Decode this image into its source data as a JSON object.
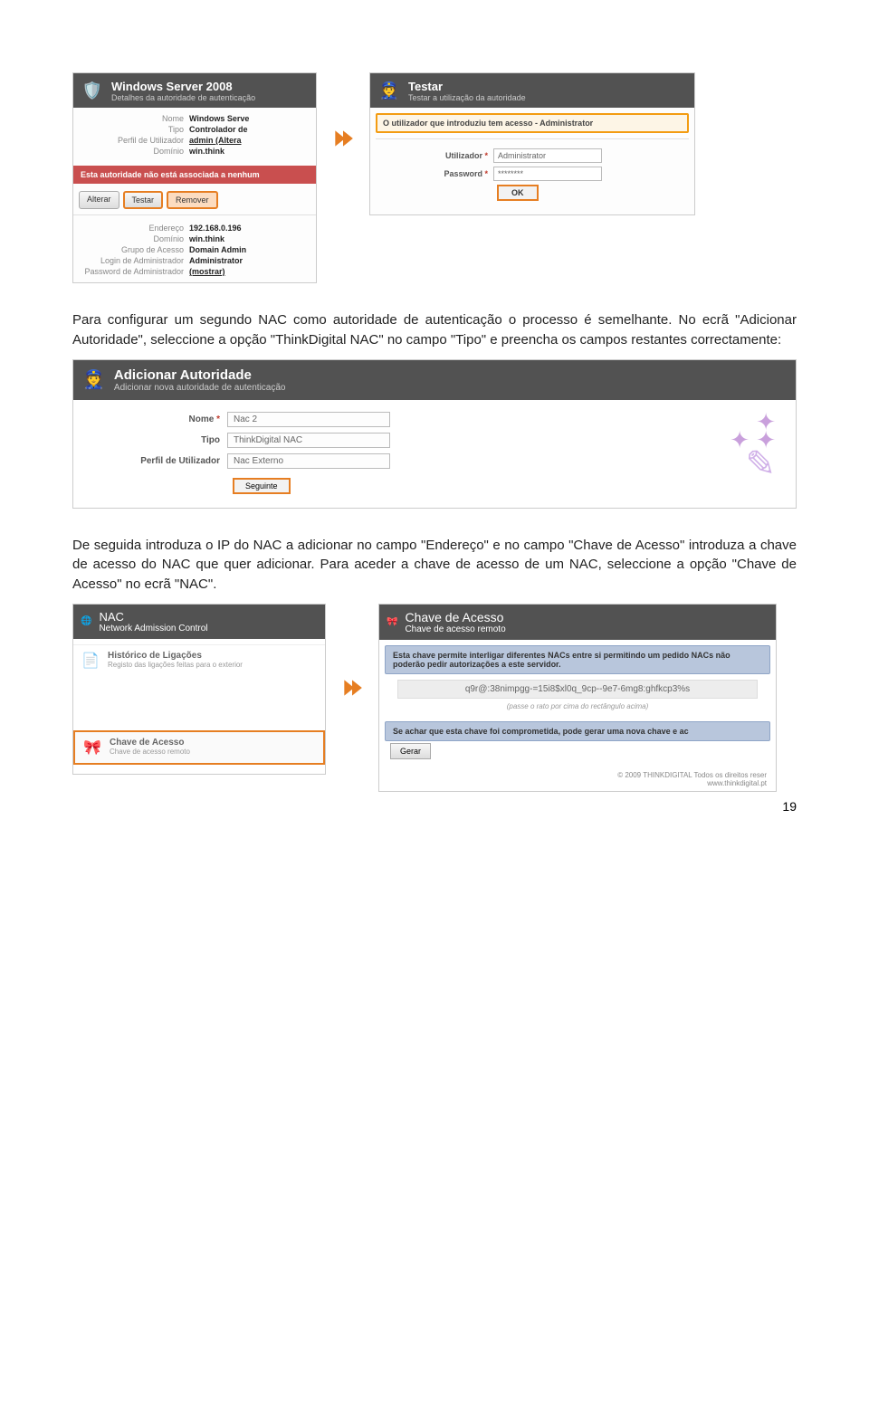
{
  "panel1": {
    "title": "Windows Server 2008",
    "subtitle": "Detalhes da autoridade de autenticação",
    "fields": {
      "nome_label": "Nome",
      "nome_value": "Windows Serve",
      "tipo_label": "Tipo",
      "tipo_value": "Controlador de",
      "perfil_label": "Perfil de Utilizador",
      "perfil_value": "admin (Altera",
      "dominio_label": "Domínio",
      "dominio_value": "win.think"
    },
    "warn": "Esta autoridade não está associada a nenhum",
    "buttons": {
      "alterar": "Alterar",
      "testar": "Testar",
      "remover": "Remover"
    },
    "fields2": {
      "endereco_label": "Endereço",
      "endereco_value": "192.168.0.196",
      "dominio2_label": "Domínio",
      "dominio2_value": "win.think",
      "grupo_label": "Grupo de Acesso",
      "grupo_value": "Domain Admin",
      "login_label": "Login de Administrador",
      "login_value": "Administrator",
      "pass_label": "Password de Administrador",
      "pass_value": "(mostrar)"
    }
  },
  "panel2": {
    "title": "Testar",
    "subtitle": "Testar a utilização da autoridade",
    "info": "O utilizador que introduziu tem acesso - Administrator",
    "utilizador_label": "Utilizador",
    "utilizador_value": "Administrator",
    "password_label": "Password",
    "password_value": "********",
    "ok": "OK"
  },
  "para1": "Para configurar um segundo NAC como autoridade de autenticação o processo é semelhante. No ecrã \"Adicionar Autoridade\", seleccione a opção \"ThinkDigital NAC\" no campo \"Tipo\" e preencha os campos restantes correctamente:",
  "addpanel": {
    "title": "Adicionar Autoridade",
    "subtitle": "Adicionar nova autoridade de autenticação",
    "nome_label": "Nome",
    "nome_value": "Nac 2",
    "tipo_label": "Tipo",
    "tipo_value": "ThinkDigital NAC",
    "perfil_label": "Perfil de Utilizador",
    "perfil_value": "Nac Externo",
    "seguinte": "Seguinte"
  },
  "para2": "De seguida introduza o IP do NAC a adicionar no campo \"Endereço\" e no campo \"Chave de Acesso\" introduza a chave de acesso do NAC que quer adicionar. Para aceder a chave de acesso de um NAC, seleccione a opção \"Chave de Acesso\" no ecrã \"NAC\".",
  "nacpanel": {
    "title": "NAC",
    "subtitle": "Network Admission Control",
    "hist_title": "Histórico de Ligações",
    "hist_sub": "Registo das ligações feitas para o exterior",
    "chave_title": "Chave de Acesso",
    "chave_sub": "Chave de acesso remoto"
  },
  "chavepanel": {
    "title": "Chave de Acesso",
    "subtitle": "Chave de acesso remoto",
    "info1": "Esta chave permite interligar diferentes NACs entre si permitindo um pedido NACs não poderão pedir autorizações a este servidor.",
    "key": "q9r@:38nimpgg-=15i8$xl0q_9cp--9e7-6mg8:ghfkcp3%s",
    "hint": "(passe o rato por cima do rectângulo acima)",
    "info2": "Se achar que esta chave foi comprometida, pode gerar uma nova chave e ac",
    "gerar": "Gerar",
    "footer1": "© 2009 THINKDIGITAL Todos os direitos reser",
    "footer2": "www.thinkdigital.pt"
  },
  "pagenum": "19"
}
